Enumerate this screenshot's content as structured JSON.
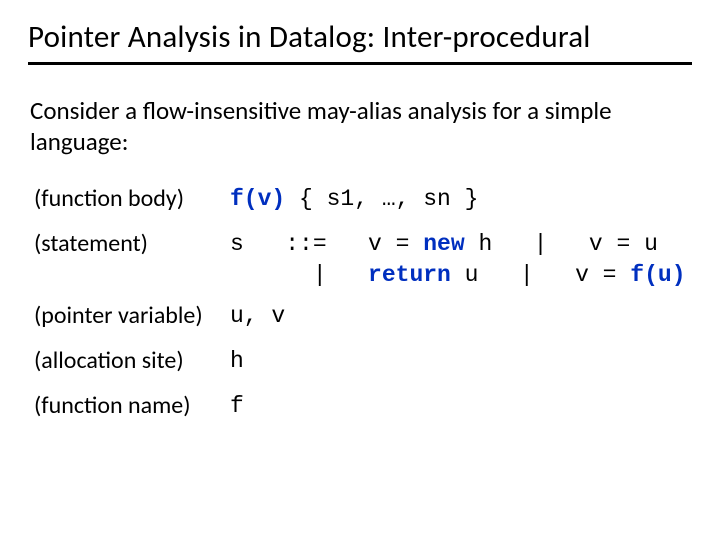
{
  "title": "Pointer Analysis in Datalog: Inter-procedural",
  "intro": "Consider a flow-insensitive may-alias analysis for a simple language:",
  "grammar": {
    "funcbody": {
      "label": "(function body)",
      "lhs_kw": "f(v)",
      "rest": " { s1, …, sn }"
    },
    "statement": {
      "label": "(statement)",
      "line1_a": "s   ::=   v = ",
      "line1_kw": "new",
      "line1_b": " h   |   v = u",
      "line2_a": "      |   ",
      "line2_kw": "return",
      "line2_b": " u   |   v = ",
      "line2_kw2": "f(u)"
    },
    "ptrvar": {
      "label": "(pointer variable)",
      "rhs": "u, v"
    },
    "allocsite": {
      "label": "(allocation site)",
      "rhs": "h"
    },
    "funcname": {
      "label": "(function name)",
      "rhs": "f"
    }
  }
}
